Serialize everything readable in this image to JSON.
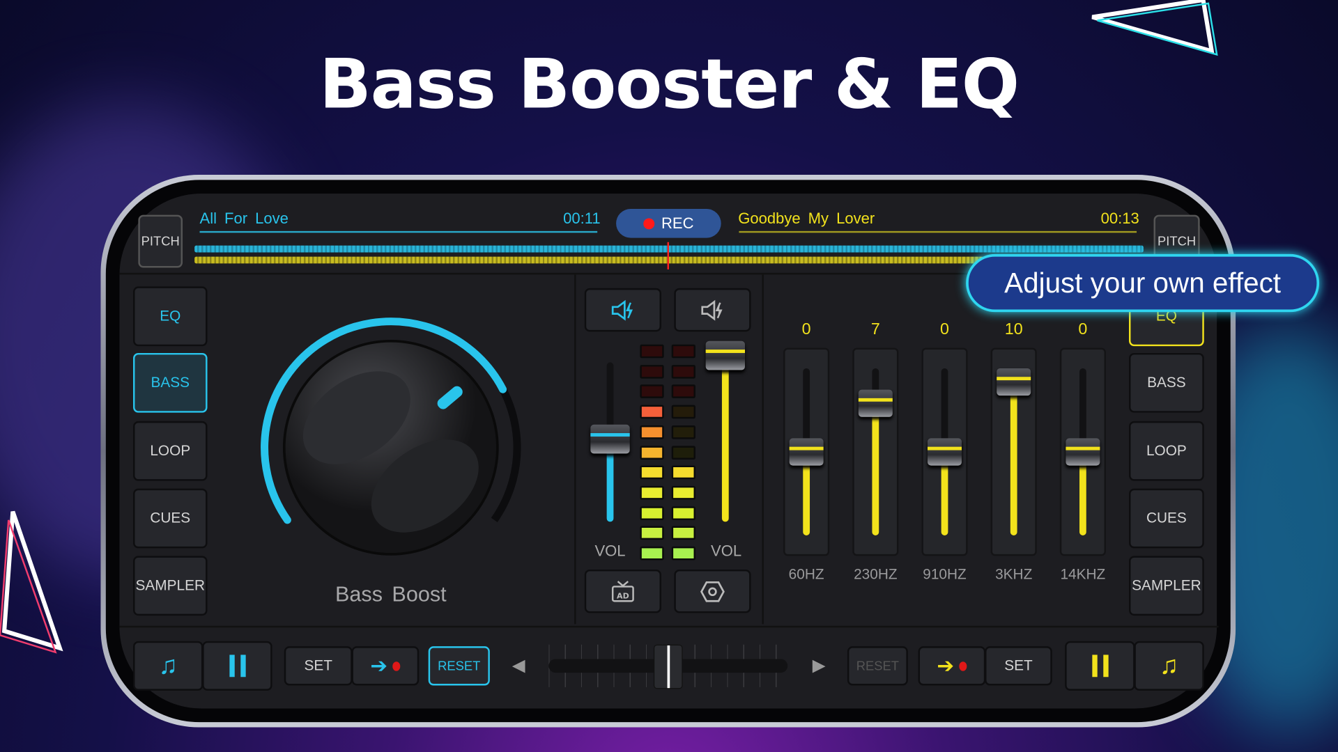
{
  "title": "Bass Booster & EQ",
  "tooltip": "Adjust your own effect",
  "deck_a": {
    "pitch": "PITCH",
    "track": "All For Love",
    "time": "00:11",
    "color": "#29c4ec",
    "volume": 0.5
  },
  "deck_b": {
    "pitch": "PITCH",
    "track": "Goodbye My Lover",
    "time": "00:13",
    "color": "#f2e21c",
    "volume": 1.0
  },
  "rec_label": "REC",
  "left_menu": [
    "EQ",
    "BASS",
    "LOOP",
    "CUES",
    "SAMPLER"
  ],
  "left_menu_active": "BASS",
  "right_menu": [
    "EQ",
    "BASS",
    "LOOP",
    "CUES",
    "SAMPLER"
  ],
  "right_menu_active": "EQ",
  "knob": {
    "label": "Bass Boost",
    "level": 0.75
  },
  "mixer": {
    "vol_left": "VOL",
    "vol_right": "VOL",
    "meter_left_lit": 8,
    "meter_right_lit": 5,
    "icons": [
      "speaker-boost-icon",
      "speaker-boost-icon",
      "ad-tv-icon",
      "settings-hex-icon"
    ]
  },
  "eq": {
    "range": [
      -12,
      12
    ],
    "bands": [
      {
        "label": "60HZ",
        "value": "0"
      },
      {
        "label": "230HZ",
        "value": "7"
      },
      {
        "label": "910HZ",
        "value": "0"
      },
      {
        "label": "3KHZ",
        "value": "10"
      },
      {
        "label": "14KHZ",
        "value": "0"
      }
    ]
  },
  "bottom": {
    "set_a": "SET",
    "reset_a": "RESET",
    "reset_b": "RESET",
    "set_b": "SET",
    "crossfader": 0.5
  },
  "colors": {
    "cyan": "#29c4ec",
    "yellow": "#f2e21c",
    "rec": "#2f5597",
    "tooltip_bg": "#1c3a8c"
  }
}
